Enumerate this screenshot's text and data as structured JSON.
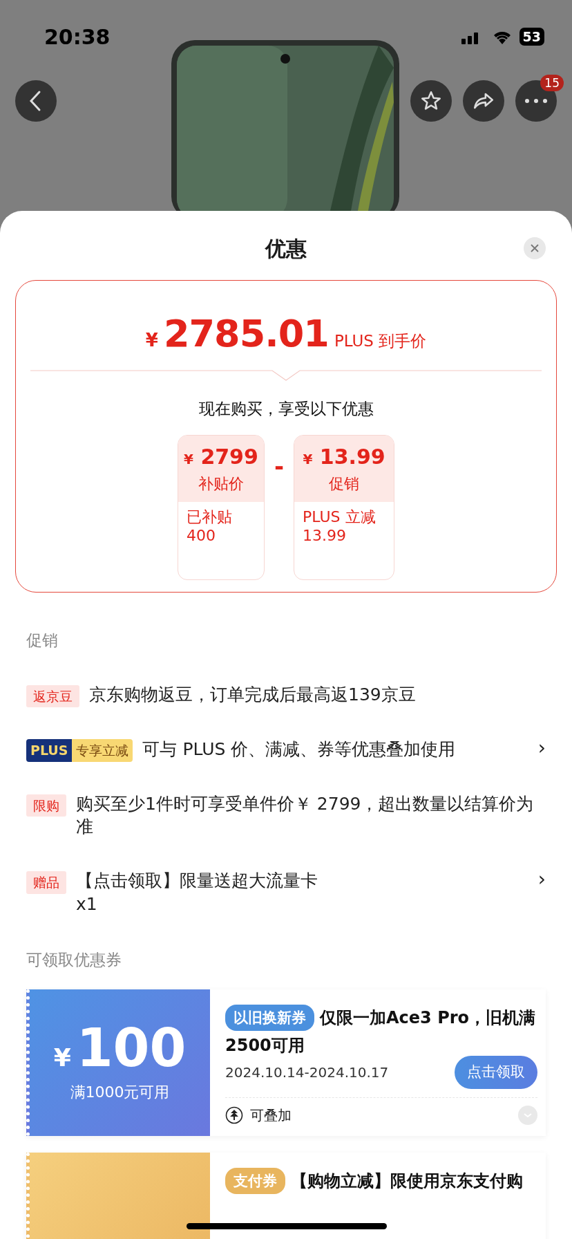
{
  "status_bar": {
    "time": "20:38",
    "battery": "53"
  },
  "nav": {
    "badge": "15"
  },
  "sheet": {
    "title": "优惠"
  },
  "price_card": {
    "currency": "¥",
    "amount": "2785.01",
    "label": "PLUS 到手价",
    "subtitle": "现在购买，享受以下优惠",
    "operator": "-",
    "items": [
      {
        "currency": "¥",
        "amount": "2799",
        "label": "补贴价",
        "detail": [
          "已补贴",
          "400"
        ]
      },
      {
        "currency": "¥",
        "amount": "13.99",
        "label": "促销",
        "detail": [
          "PLUS 立减",
          "13.99"
        ]
      }
    ]
  },
  "promotions": {
    "title": "促销",
    "items": [
      {
        "kind": "tag",
        "tag": "返京豆",
        "text": [
          "京东购物返豆，订单完成后最高返139京豆"
        ]
      },
      {
        "kind": "plus",
        "tag": "PLUS",
        "tag_extra": "专享立减",
        "text": [
          "可与 PLUS 价、满减、券等优惠叠加使用"
        ],
        "chevron": "›"
      },
      {
        "kind": "tag",
        "tag": "限购",
        "text": [
          "购买至少1件时可享受单件价￥ 2799，超出数量以结算价为准"
        ]
      },
      {
        "kind": "tag",
        "tag": "赠品",
        "text": [
          "【点击领取】限量送超大流量卡",
          "x1"
        ],
        "chevron": "›"
      }
    ]
  },
  "coupons": {
    "title": "可领取优惠券",
    "items": [
      {
        "kind": "blue",
        "currency": "¥",
        "amount": "100",
        "condition": "满1000元可用",
        "tag": "以旧换新券",
        "title": [
          "仅限一加Ace3 Pro，旧机满",
          "2500可用"
        ],
        "date": "2024.10.14-2024.10.17",
        "button": "点击领取",
        "stack_label": "可叠加"
      },
      {
        "kind": "gold",
        "tag": "支付券",
        "title": [
          "【购物立减】限使用京东支付购"
        ]
      }
    ]
  }
}
